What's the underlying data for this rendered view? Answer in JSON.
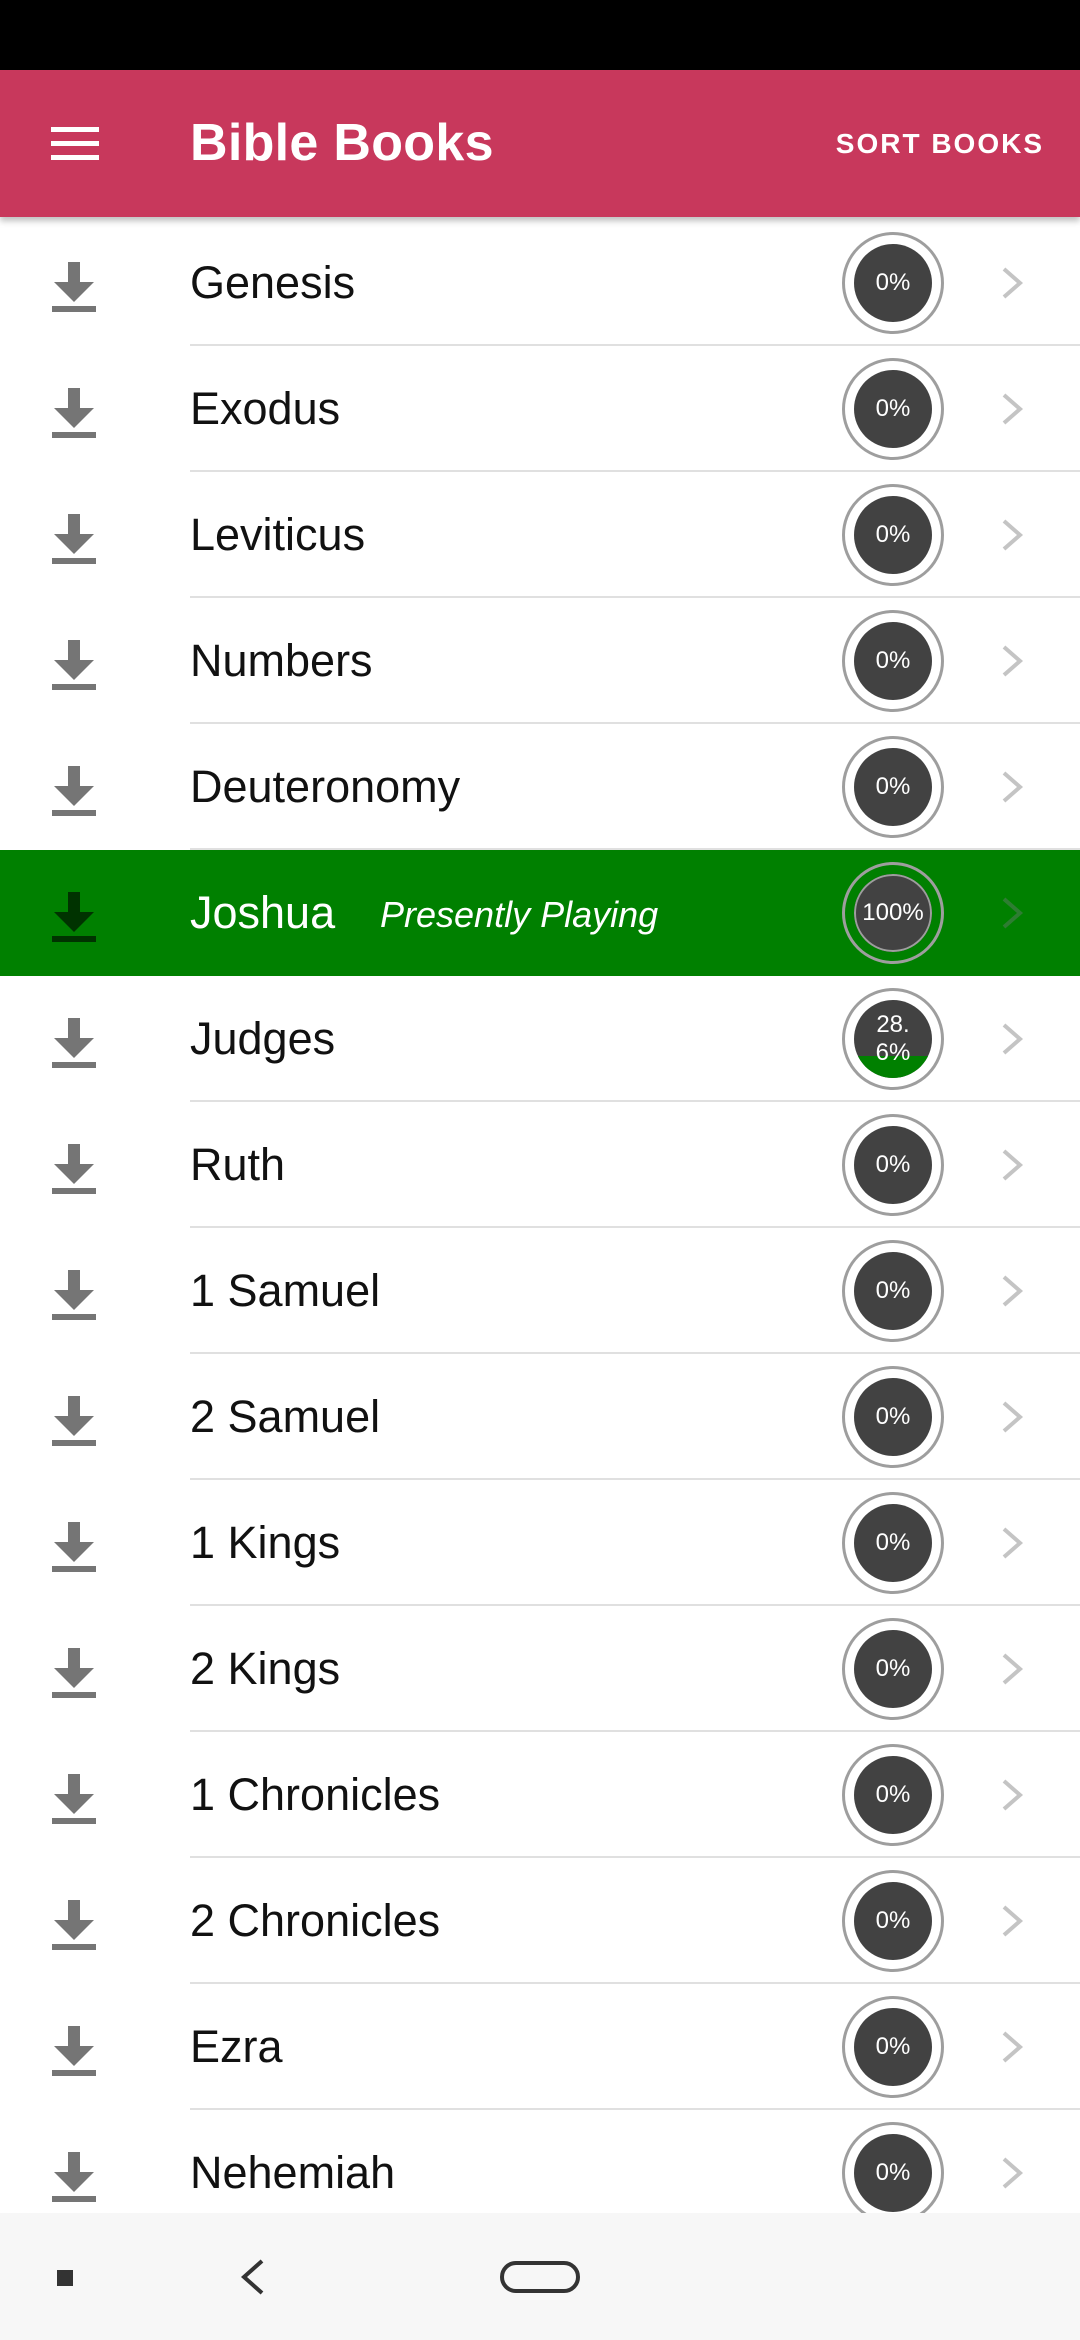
{
  "app_bar": {
    "title": "Bible Books",
    "sort_label": "SORT BOOKS",
    "color": "#c8385c"
  },
  "colors": {
    "playing_row": "#008000",
    "progress_disc": "#424242",
    "progress_fill": "#008000",
    "divider": "#e0e0e0"
  },
  "icons": {
    "menu": "menu-icon",
    "download": "download-icon",
    "chevron": "chevron-right-icon",
    "nav_recents": "recents-icon",
    "nav_back": "back-icon",
    "nav_home": "home-icon"
  },
  "books": [
    {
      "name": "Genesis",
      "progress_label": "0%",
      "progress": 0
    },
    {
      "name": "Exodus",
      "progress_label": "0%",
      "progress": 0
    },
    {
      "name": "Leviticus",
      "progress_label": "0%",
      "progress": 0
    },
    {
      "name": "Numbers",
      "progress_label": "0%",
      "progress": 0
    },
    {
      "name": "Deuteronomy",
      "progress_label": "0%",
      "progress": 0
    },
    {
      "name": "Joshua",
      "progress_label": "100%",
      "progress": 1.0,
      "playing": true,
      "status": "Presently Playing"
    },
    {
      "name": "Judges",
      "progress_label": "28.6%",
      "progress": 0.286
    },
    {
      "name": "Ruth",
      "progress_label": "0%",
      "progress": 0
    },
    {
      "name": "1 Samuel",
      "progress_label": "0%",
      "progress": 0
    },
    {
      "name": "2 Samuel",
      "progress_label": "0%",
      "progress": 0
    },
    {
      "name": "1 Kings",
      "progress_label": "0%",
      "progress": 0
    },
    {
      "name": "2 Kings",
      "progress_label": "0%",
      "progress": 0
    },
    {
      "name": "1 Chronicles",
      "progress_label": "0%",
      "progress": 0
    },
    {
      "name": "2 Chronicles",
      "progress_label": "0%",
      "progress": 0
    },
    {
      "name": "Ezra",
      "progress_label": "0%",
      "progress": 0
    },
    {
      "name": "Nehemiah",
      "progress_label": "0%",
      "progress": 0
    }
  ]
}
